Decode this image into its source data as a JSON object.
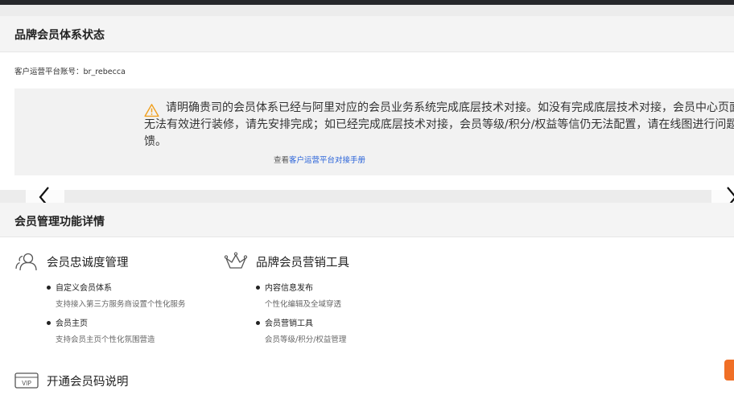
{
  "status_section": {
    "title": "品牌会员体系状态",
    "account_label": "客户运营平台账号：",
    "account_value": "br_rebecca",
    "notice_text": "请明确贵司的会员体系已经与阿里对应的会员业务系统完成底层技术对接。如没有完成底层技术对接，会员中心页面则无法有效进行装修，请先安排完成；如已经完成底层技术对接，会员等级/积分/权益等信仍无法配置，请在线图进行问题反馈。",
    "link_prefix": "查看",
    "link_text": "客户运营平台对接手册"
  },
  "features_section": {
    "title": "会员管理功能详情",
    "groups": [
      {
        "icon": "people-icon",
        "title": "会员忠诚度管理",
        "items": [
          {
            "title": "自定义会员体系",
            "desc": "支持接入第三方服务商设置个性化服务"
          },
          {
            "title": "会员主页",
            "desc": "支持会员主页个性化氛围营造"
          }
        ]
      },
      {
        "icon": "crown-icon",
        "title": "品牌会员营销工具",
        "items": [
          {
            "title": "内容信息发布",
            "desc": "个性化编辑及全域穿透"
          },
          {
            "title": "会员营销工具",
            "desc": "会员等级/积分/权益管理"
          }
        ]
      },
      {
        "icon": "vip-card-icon",
        "icon_text": "VIP",
        "title": "开通会员码说明"
      }
    ]
  },
  "colors": {
    "accent_link": "#2b64d9",
    "warning": "#f0a020",
    "float_badge": "#f06f26"
  }
}
